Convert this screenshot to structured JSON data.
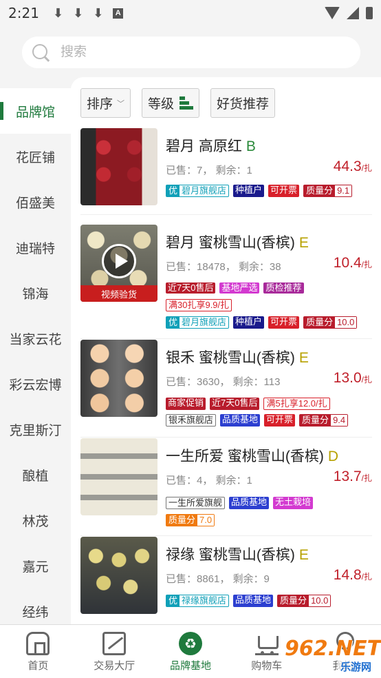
{
  "status": {
    "time": "2:21",
    "downloads": [
      "⬇",
      "⬇",
      "⬇"
    ],
    "a_badge": "A"
  },
  "search": {
    "placeholder": "搜索"
  },
  "sidebar": {
    "items": [
      {
        "label": "品牌馆",
        "active": true
      },
      {
        "label": "花匠铺"
      },
      {
        "label": "佰盛美"
      },
      {
        "label": "迪瑞特"
      },
      {
        "label": "锦海"
      },
      {
        "label": "当家云花"
      },
      {
        "label": "彩云宏博"
      },
      {
        "label": "克里斯汀"
      },
      {
        "label": "酿植"
      },
      {
        "label": "林茂"
      },
      {
        "label": "嘉元"
      },
      {
        "label": "经纬"
      }
    ]
  },
  "filters": {
    "sort": "排序",
    "grade": "等级",
    "recommend": "好货推荐"
  },
  "products": [
    {
      "name": "碧月 高原红",
      "grade": "B",
      "sold": "已售：7， 剩余：1",
      "price": "44.3",
      "unit": "/扎",
      "tags": {
        "shop_pre": "优",
        "shop": "碧月旗舰店",
        "t2": "种植户",
        "t3": "可开票",
        "score_label": "质量分",
        "score": "9.1"
      }
    },
    {
      "name": "碧月 蜜桃雪山(香槟)",
      "grade": "E",
      "sold": "已售：18478， 剩余：38",
      "price": "10.4",
      "unit": "/扎",
      "video": "视频验货",
      "tags_row1": [
        "近7天0售后",
        "基地严选",
        "质检推荐"
      ],
      "promo": "满30扎享9.9/扎",
      "tags": {
        "shop_pre": "优",
        "shop": "碧月旗舰店",
        "t2": "种植户",
        "t3": "可开票",
        "score_label": "质量分",
        "score": "10.0"
      }
    },
    {
      "name": "银禾 蜜桃雪山(香槟)",
      "grade": "E",
      "sold": "已售：3630， 剩余：113",
      "price": "13.0",
      "unit": "/扎",
      "tags_row1": [
        "商家促销",
        "近7天0售后",
        "满5扎享12.0/扎"
      ],
      "tags": {
        "shop": "银禾旗舰店",
        "t2": "品质基地",
        "t3": "可开票",
        "score_label": "质量分",
        "score": "9.4"
      }
    },
    {
      "name": "一生所爱 蜜桃雪山(香槟)",
      "grade": "D",
      "sold": "已售：4， 剩余：1",
      "price": "13.7",
      "unit": "/扎",
      "tags": {
        "shop": "一生所爱旗舰",
        "t2": "品质基地",
        "t3": "无土栽培",
        "score_label": "质量分",
        "score": "7.0"
      }
    },
    {
      "name": "禄缘 蜜桃雪山(香槟)",
      "grade": "E",
      "sold": "已售：8861， 剩余：9",
      "price": "14.8",
      "unit": "/扎",
      "tags": {
        "shop_pre": "优",
        "shop": "禄缘旗舰店",
        "t2": "品质基地",
        "score_label": "质量分",
        "score": "10.0"
      }
    }
  ],
  "bottom_nav": [
    {
      "label": "首页"
    },
    {
      "label": "交易大厅"
    },
    {
      "label": "品牌基地",
      "active": true
    },
    {
      "label": "购物车"
    },
    {
      "label": "我的"
    }
  ],
  "watermark": {
    "big": "962.NET",
    "small": "乐游网"
  },
  "colors": {
    "brand_green": "#1f7a3d",
    "price_red": "#c0202a"
  }
}
